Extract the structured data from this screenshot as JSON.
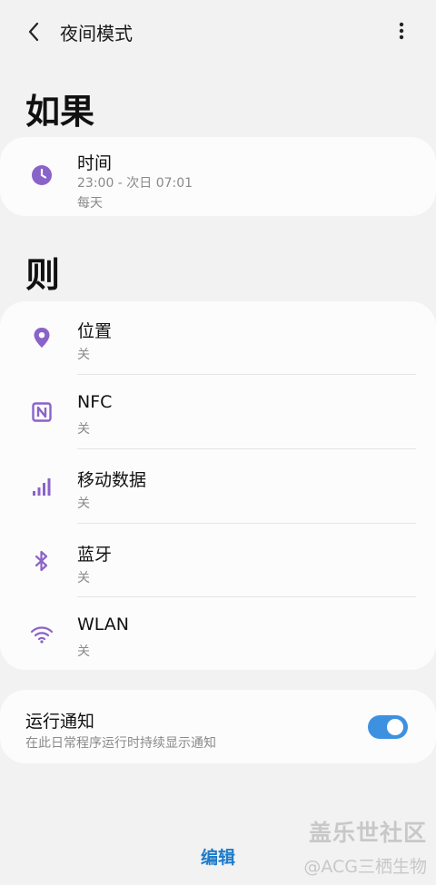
{
  "header": {
    "title": "夜间模式",
    "back_icon": "chevron-left-icon",
    "more_icon": "more-vertical-icon"
  },
  "if_section": {
    "heading": "如果",
    "time": {
      "icon": "clock-icon",
      "title": "时间",
      "range": "23:00 - 次日 07:01",
      "repeat": "每天"
    }
  },
  "then_section": {
    "heading": "则",
    "items": [
      {
        "icon": "location-pin-icon",
        "title": "位置",
        "status": "关"
      },
      {
        "icon": "nfc-icon",
        "title": "NFC",
        "status": "关"
      },
      {
        "icon": "signal-bars-icon",
        "title": "移动数据",
        "status": "关"
      },
      {
        "icon": "bluetooth-icon",
        "title": "蓝牙",
        "status": "关"
      },
      {
        "icon": "wifi-icon",
        "title": "WLAN",
        "status": "关"
      }
    ]
  },
  "notification": {
    "title": "运行通知",
    "description": "在此日常程序运行时持续显示通知",
    "enabled": true
  },
  "bottom": {
    "edit_label": "编辑"
  },
  "watermark": {
    "line1": "盖乐世社区",
    "line2": "@ACG三栖生物"
  },
  "colors": {
    "accent_purple": "#8a63c9",
    "toggle_blue": "#3e91e0",
    "edit_blue": "#1e7bc9"
  }
}
